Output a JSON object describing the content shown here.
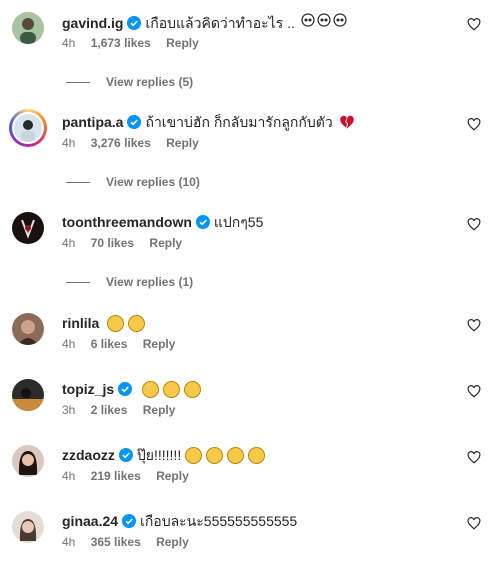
{
  "comments": [
    {
      "username": "gavind.ig",
      "text": "เกือบแล้วคิดว่าทำอะไร ..",
      "time": "4h",
      "likes": "1,673 likes",
      "reply": "Reply",
      "emoji": "skull",
      "emoji_count": 3,
      "verified": true,
      "replies": "View replies (5)"
    },
    {
      "username": "pantipa.a",
      "text": "ถ้าเขาบ่ฮัก ก็กลับมารักลูกกับตัว",
      "time": "4h",
      "likes": "3,276 likes",
      "reply": "Reply",
      "emoji": "broken-heart",
      "emoji_count": 1,
      "verified": true,
      "replies": "View replies (10)"
    },
    {
      "username": "toonthreemandown",
      "text": "แปกๆ55",
      "time": "4h",
      "likes": "70 likes",
      "reply": "Reply",
      "verified": true,
      "replies": "View replies (1)"
    },
    {
      "username": "rinlila",
      "text": "",
      "time": "4h",
      "likes": "6 likes",
      "reply": "Reply",
      "emoji": "laughing",
      "emoji_count": 2,
      "verified": false
    },
    {
      "username": "topiz_js",
      "text": "",
      "time": "3h",
      "likes": "2 likes",
      "reply": "Reply",
      "emoji": "laughing",
      "emoji_count": 3,
      "verified": true
    },
    {
      "username": "zzdaozz",
      "text": "ปุ๊ย!!!!!!!",
      "time": "4h",
      "likes": "219 likes",
      "reply": "Reply",
      "emoji": "laughing",
      "emoji_count": 4,
      "verified": true
    },
    {
      "username": "ginaa.24",
      "text": "เกือบละนะ555555555555",
      "time": "4h",
      "likes": "365 likes",
      "reply": "Reply",
      "verified": true
    }
  ],
  "colors": {
    "verified": "#0095f6",
    "muted": "#737373",
    "text": "#262626",
    "emoji_laugh": "#f7c948"
  }
}
